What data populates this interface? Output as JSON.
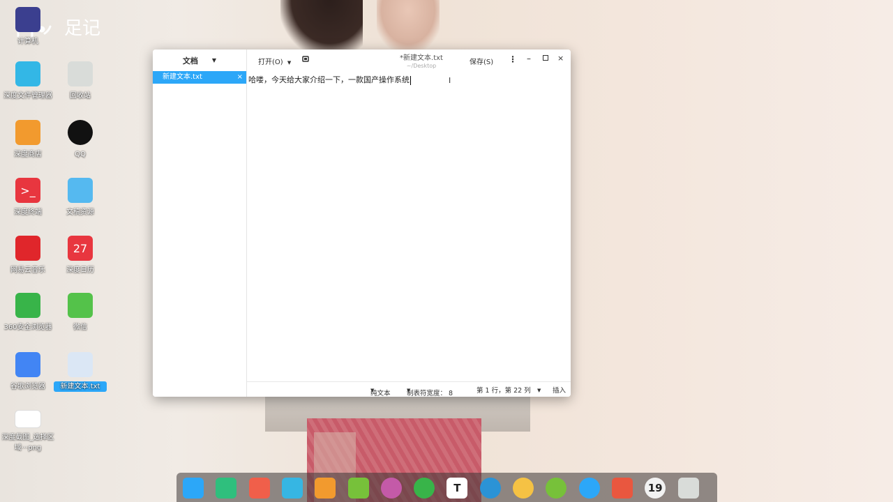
{
  "watermark": {
    "text": "足记"
  },
  "desktop_icons": [
    {
      "label": "计算机",
      "color": "#3b3f8f"
    },
    {
      "label": "深度文件管理器",
      "color": "#33b7e6"
    },
    {
      "label": "深度商店",
      "color": "#f29a2e"
    },
    {
      "label": "深度终端",
      "color": "#e8363f",
      "glyph": ">_"
    },
    {
      "label": "网易云音乐",
      "color": "#e0262b"
    },
    {
      "label": "360安全浏览器",
      "color": "#38b449"
    },
    {
      "label": "谷歌浏览器",
      "color": "#4285f4"
    },
    {
      "label": "深度截图_选择区域···png",
      "color": "#ffffff"
    },
    {
      "label": "回收站",
      "color": "#d9dcd9"
    },
    {
      "label": "QQ",
      "color": "#111111"
    },
    {
      "label": "文稿资源",
      "color": "#55b9f0"
    },
    {
      "label": "深度日历",
      "color": "#e8363f",
      "glyph": "27"
    },
    {
      "label": "微信",
      "color": "#54c24a"
    },
    {
      "label": "新建文本.txt",
      "color": "#dbe7f5"
    }
  ],
  "window": {
    "sidebar_title": "文档",
    "tab_label": "新建文本.txt",
    "tab_close": "×",
    "open_label": "打开(O)",
    "file_title": "*新建文本.txt",
    "file_path": "~/Desktop",
    "save_label": "保存(S)",
    "menu_glyph": "⋮",
    "min_glyph": "–",
    "close_glyph": "×",
    "editor_text": "哈喽，今天给大家介绍一下，一款国产操作系统",
    "ibeam_glyph": "I"
  },
  "status_bar": {
    "syntax": "纯文本",
    "tab_width": "制表符宽度： 8",
    "position": "第 1 行，第 22 列",
    "mode": "插入"
  },
  "dock_items": [
    {
      "name": "launcher",
      "color": "#2ca7f8"
    },
    {
      "name": "multitasking",
      "color": "#2fbf7d"
    },
    {
      "name": "screen-record",
      "color": "#f05f4a"
    },
    {
      "name": "file-manager",
      "color": "#36b6e3"
    },
    {
      "name": "store",
      "color": "#f29a2e"
    },
    {
      "name": "music",
      "color": "#77c13a"
    },
    {
      "name": "settings",
      "color": "#c45aa8"
    },
    {
      "name": "browser-360",
      "color": "#38b449"
    },
    {
      "name": "text-editor",
      "color": "#ffffff",
      "glyph": "T"
    },
    {
      "name": "recorder",
      "color": "#2b93d6"
    },
    {
      "name": "clock",
      "color": "#f5c244"
    },
    {
      "name": "power",
      "color": "#77c13a"
    },
    {
      "name": "network",
      "color": "#2ca7f8"
    },
    {
      "name": "screenshot",
      "color": "#e9573f"
    },
    {
      "name": "system-monitor",
      "color": "#f2f2f2",
      "glyph": "19"
    },
    {
      "name": "trash",
      "color": "#d9dcd9"
    }
  ]
}
